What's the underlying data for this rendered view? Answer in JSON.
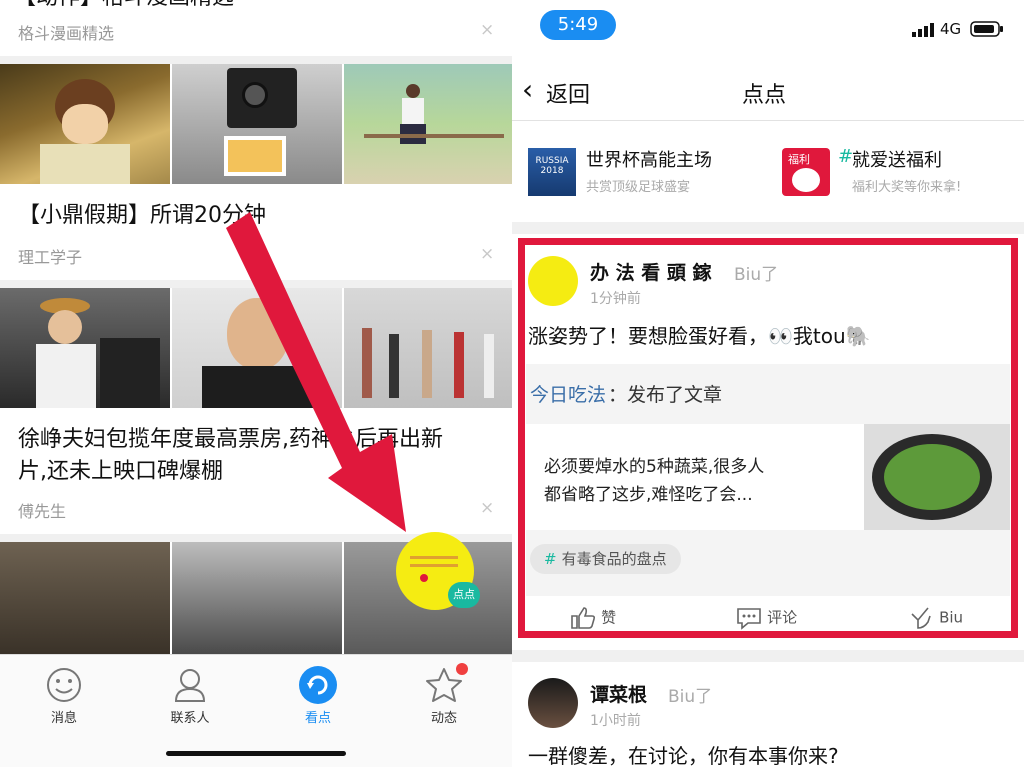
{
  "left": {
    "top_partial_title": "【动作】格斗漫画精选",
    "cards": [
      {
        "source": "格斗漫画精选",
        "close": "×"
      },
      {
        "title": "【小鼎假期】所谓20分钟",
        "source": "理工学子",
        "close": "×"
      },
      {
        "title_line1": "徐峥夫妇包揽年度最高票房,药神之后再出新",
        "title_line2": "片,还未上映口碑爆棚",
        "source": "傅先生",
        "close": "×"
      }
    ],
    "floating_badge": "点点",
    "tabs": [
      {
        "label": "消息",
        "icon": "smile-icon"
      },
      {
        "label": "联系人",
        "icon": "contact-icon"
      },
      {
        "label": "看点",
        "icon": "refresh-icon",
        "active": true
      },
      {
        "label": "动态",
        "icon": "star-icon",
        "badge": true
      }
    ]
  },
  "status": {
    "time": "5:49",
    "network": "4G"
  },
  "nav": {
    "back": "返回",
    "title": "点点"
  },
  "topics": [
    {
      "name": "世界杯高能主场",
      "desc": "共赏顶级足球盛宴",
      "thumb_text": "RUSSIA 2018"
    },
    {
      "name": "就爱送福利",
      "hash": "#",
      "desc": "福利大奖等你来拿!",
      "thumb_text": "福利"
    }
  ],
  "post1": {
    "author": "办 法 看 頭 鎵",
    "action": "Biu了",
    "time": "1分钟前",
    "text": "涨姿势了！要想脸蛋好看，👀我tou🐘",
    "share_source": "今日吃法",
    "share_action": "：发布了文章",
    "article_line1": "必须要焯水的5种蔬菜,很多人",
    "article_line2": "都省略了这步,难怪吃了会...",
    "tag_hash": "#",
    "tag": "有毒食品的盘点",
    "actions": {
      "like": "赞",
      "comment": "评论",
      "biu": "Biu"
    }
  },
  "post2": {
    "author": "谭菜根",
    "action": "Biu了",
    "time": "1小时前",
    "text": "一群傻差，在讨论，你有本事你来?"
  },
  "colors": {
    "highlight": "#e0183c",
    "accent_blue": "#1a8df2",
    "tag_green": "#19b9a0"
  }
}
